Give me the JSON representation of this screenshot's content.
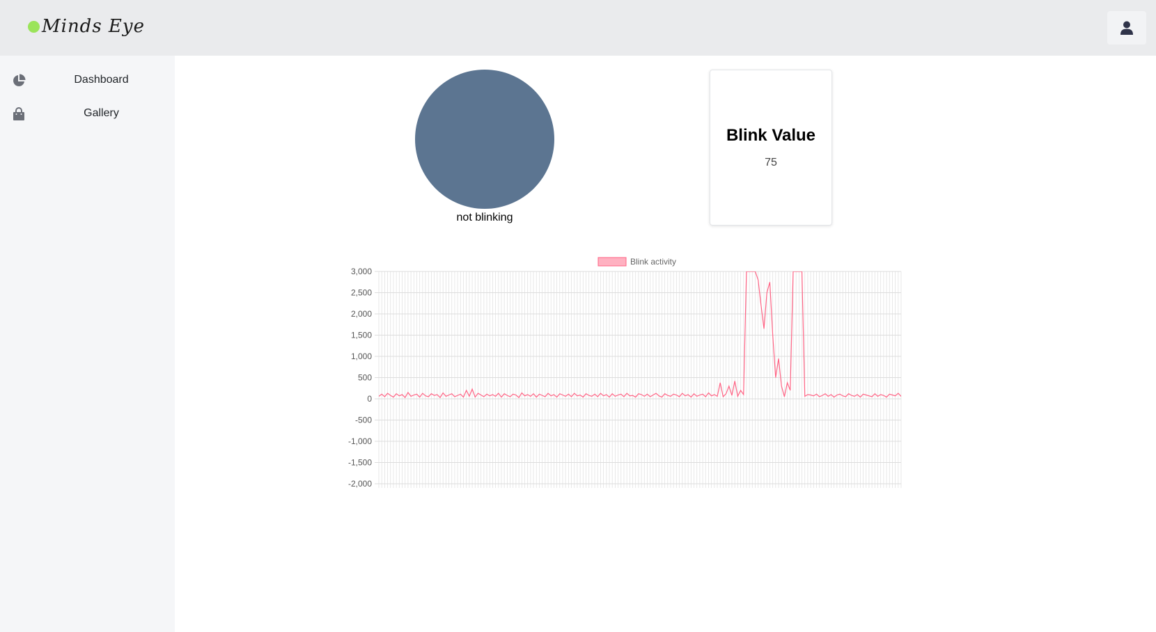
{
  "app": {
    "name": "Minds Eye",
    "accent": "#9be45a"
  },
  "header": {
    "user_icon": "user-icon"
  },
  "sidebar": {
    "items": [
      {
        "label": "Dashboard",
        "icon": "pie-chart-icon"
      },
      {
        "label": "Gallery",
        "icon": "shopping-bag-icon"
      }
    ]
  },
  "status": {
    "label": "not blinking",
    "color": "#5c7591"
  },
  "card": {
    "title": "Blink Value",
    "value": "75"
  },
  "chart_data": {
    "type": "line",
    "legend": "Blink activity",
    "color": "#ff6384",
    "ylim": [
      -2000,
      3000
    ],
    "yticks": [
      3000,
      2500,
      2000,
      1500,
      1000,
      500,
      0,
      -500,
      -1000,
      -1500,
      -2000
    ],
    "ytick_labels": [
      "3,000",
      "2,500",
      "2,000",
      "1,500",
      "1,000",
      "500",
      "0",
      "-500",
      "-1,000",
      "-1,500",
      "-2,000"
    ],
    "grid": true,
    "x_count": 180,
    "values": [
      60,
      110,
      50,
      130,
      80,
      40,
      120,
      70,
      100,
      30,
      150,
      60,
      90,
      110,
      40,
      130,
      70,
      50,
      120,
      80,
      100,
      30,
      140,
      60,
      90,
      120,
      50,
      80,
      110,
      40,
      200,
      60,
      230,
      40,
      130,
      90,
      50,
      110,
      70,
      100,
      60,
      130,
      40,
      120,
      80,
      50,
      110,
      90,
      30,
      140,
      70,
      100,
      60,
      120,
      40,
      110,
      80,
      50,
      130,
      70,
      100,
      40,
      120,
      90,
      60,
      110,
      50,
      130,
      70,
      90,
      40,
      120,
      80,
      60,
      110,
      50,
      130,
      70,
      100,
      40,
      120,
      60,
      90,
      110,
      50,
      130,
      70,
      80,
      40,
      120,
      100,
      60,
      110,
      50,
      90,
      130,
      70,
      40,
      120,
      80,
      60,
      110,
      90,
      50,
      130,
      70,
      100,
      40,
      120,
      60,
      90,
      110,
      50,
      140,
      70,
      100,
      60,
      380,
      50,
      120,
      300,
      80,
      420,
      60,
      200,
      100,
      3000,
      3000,
      3000,
      3000,
      2800,
      2200,
      1650,
      2500,
      2750,
      1500,
      500,
      950,
      300,
      50,
      380,
      200,
      3000,
      3000,
      3000,
      3000,
      60,
      100,
      90,
      70,
      110,
      50,
      80,
      120,
      60,
      100,
      40,
      90,
      110,
      70,
      50,
      120,
      80,
      60,
      100,
      40,
      110,
      90,
      70,
      50,
      120,
      60,
      100,
      80,
      40,
      110,
      90,
      70,
      130,
      60,
      100,
      50,
      120,
      80
    ]
  }
}
